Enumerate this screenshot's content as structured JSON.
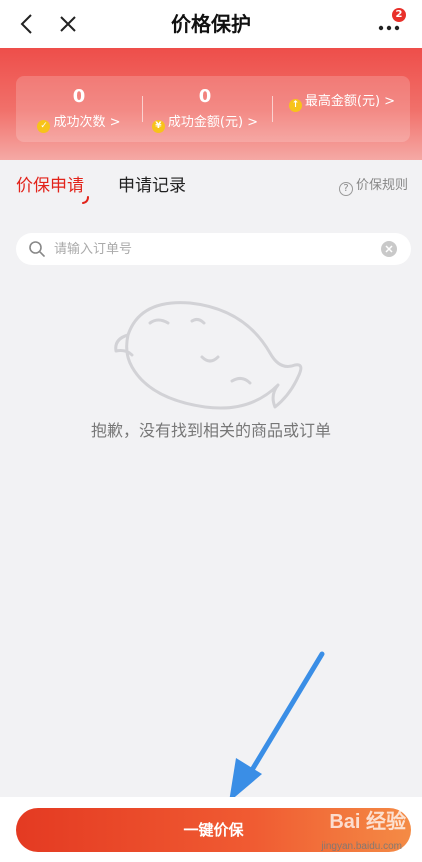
{
  "nav": {
    "title": "价格保护",
    "badge": "2"
  },
  "stats": [
    {
      "value": "0",
      "label": "成功次数 >"
    },
    {
      "value": "0",
      "label": "成功金额(元) >"
    },
    {
      "value": "",
      "label": "最高金额(元) >"
    }
  ],
  "tabs": {
    "active": "价保申请",
    "second": "申请记录",
    "rules": "价保规则"
  },
  "search": {
    "placeholder": "请输入订单号"
  },
  "empty": {
    "message": "抱歉，没有找到相关的商品或订单"
  },
  "bottom": {
    "cta": "一键价保"
  },
  "watermark": {
    "brand": "Bai 经验",
    "url": "jingyan.baidu.com"
  },
  "colors": {
    "accent": "#e2231a",
    "hero_top": "#ee4e4a",
    "coin": "#f7c31a",
    "annotation_arrow": "#3a8ee6"
  },
  "icons": [
    "back-icon",
    "close-icon",
    "more-icon",
    "check-coin-icon",
    "yen-coin-icon",
    "up-coin-icon",
    "help-icon",
    "search-icon",
    "clear-icon",
    "empty-mascot-icon"
  ]
}
